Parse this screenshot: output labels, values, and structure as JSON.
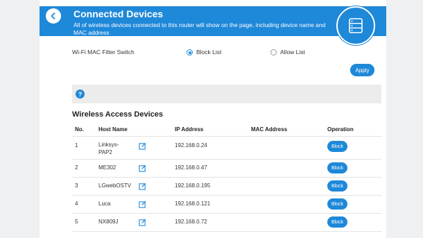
{
  "header": {
    "title": "Connected Devices",
    "description": "All of wireless devices connected to this router will show on the page, including device name and MAC address",
    "back_icon": "chevron-left-icon",
    "hero_icon": "router-list-icon"
  },
  "filter": {
    "label": "Wi-Fi MAC Filter Switch",
    "options": [
      "Block List",
      "Allow List"
    ],
    "selected": "Block List"
  },
  "apply_label": "Apply",
  "help_icon": "?",
  "section_title": "Wireless Access Devices",
  "table": {
    "headers": [
      "No.",
      "Host Name",
      "IP Address",
      "MAC Address",
      "Operation"
    ],
    "rows": [
      {
        "no": "1",
        "host_line1": "Linksys-",
        "host_line2": "PAP2",
        "ip": "192.168.0.24",
        "mac": "",
        "op": "Block"
      },
      {
        "no": "2",
        "host_line1": "ME302",
        "host_line2": "",
        "ip": "192.168.0.47",
        "mac": "",
        "op": "Block"
      },
      {
        "no": "3",
        "host_line1": "LGwebOSTV",
        "host_line2": "",
        "ip": "192.168.0.195",
        "mac": "",
        "op": "Block"
      },
      {
        "no": "4",
        "host_line1": "Luca",
        "host_line2": "",
        "ip": "192.168.0.121",
        "mac": "",
        "op": "Block"
      },
      {
        "no": "5",
        "host_line1": "NX809J",
        "host_line2": "",
        "ip": "192.168.0.72",
        "mac": "",
        "op": "Block"
      }
    ]
  },
  "colors": {
    "accent": "#1e88d9",
    "background": "#eef0f2"
  }
}
